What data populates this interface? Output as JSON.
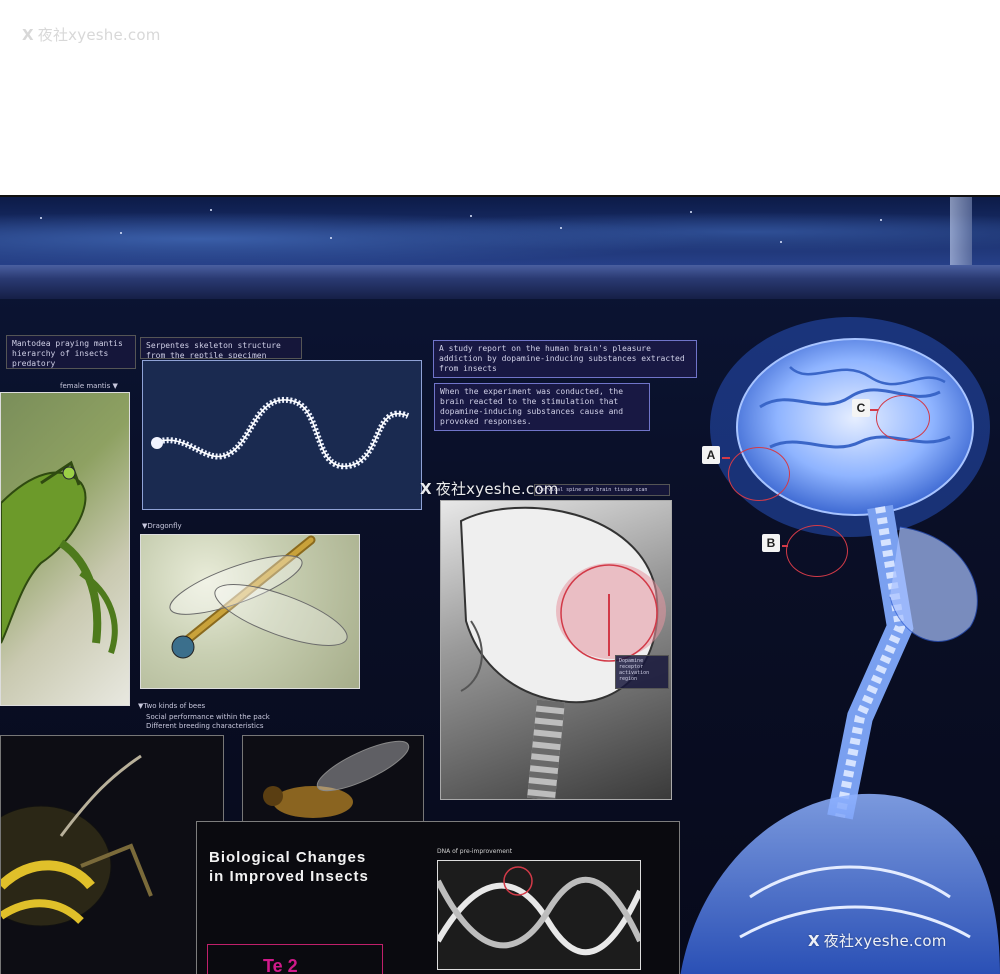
{
  "watermark": {
    "x_symbol": "X",
    "top": "夜社xyeshe.com",
    "middle": "夜社xyeshe.com",
    "bottom": "夜社xyeshe.com"
  },
  "labels": {
    "mantis_box": "Mantodea praying mantis hierarchy of insects predatory",
    "snake_box": "Serpentes skeleton structure from the reptile specimen",
    "female_mantis": "female mantis ▼",
    "dragonfly": "▼Dragonfly",
    "bees_title": "▼Two kinds of bees",
    "bees_line1": "Social performance within the pack",
    "bees_line2": "Different breeding characteristics",
    "study_report": "A study report on the human brain's pleasure addiction by dopamine-inducing substances extracted from insects",
    "study_detail": "When the experiment was conducted, the brain reacted to the stimulation that dopamine-inducing substances cause and provoked responses.",
    "xray_caption": "Cervical spine and brain tissue scan",
    "xray_note": "Dopamine receptor activation region"
  },
  "callouts": {
    "a": "A",
    "b": "B",
    "c": "C"
  },
  "bio_panel": {
    "title_line1": "Biological Changes",
    "title_line2": "in Improved Insects",
    "dna_caption": "DNA of pre-improvement",
    "magenta_text": "Te 2"
  },
  "colors": {
    "panel_bg": "#0a0f27",
    "accent_red": "#d23a48",
    "brain_blue": "#6ea0ff",
    "label_border": "#7074c9"
  }
}
